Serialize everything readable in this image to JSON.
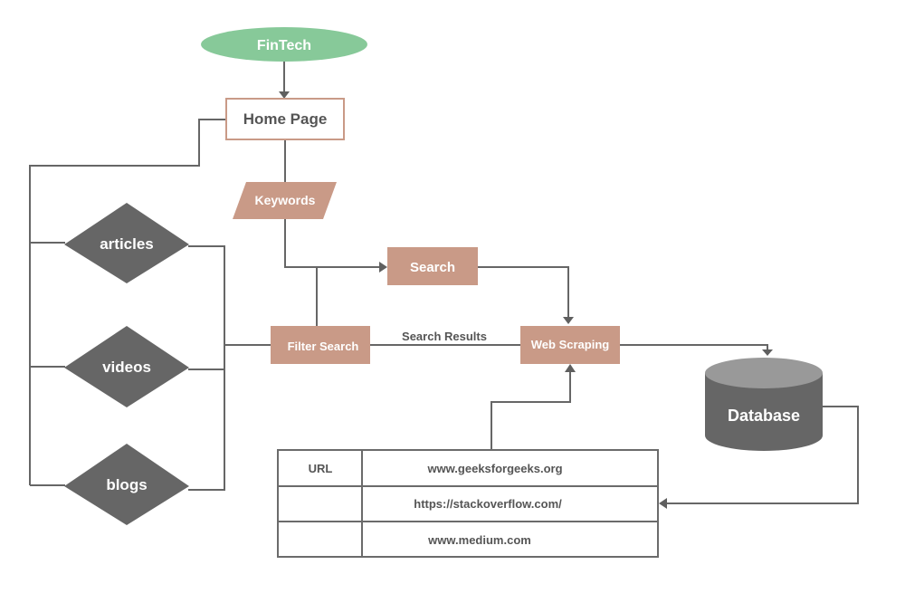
{
  "diagram": {
    "colors": {
      "terminal": "#87c999",
      "process": "#c99a87",
      "decision": "#666666",
      "database_body": "#666666",
      "database_top": "#999999",
      "edge": "#666666",
      "text_light": "#ffffff",
      "text_dark": "#555555"
    },
    "nodes": {
      "fintech": {
        "label": "FinTech",
        "shape": "ellipse"
      },
      "home_page": {
        "label": "Home Page",
        "shape": "rectangle-outline"
      },
      "keywords": {
        "label": "Keywords",
        "shape": "parallelogram"
      },
      "search": {
        "label": "Search",
        "shape": "rectangle"
      },
      "filter_search": {
        "label": "Filter Search",
        "shape": "rectangle"
      },
      "web_scraping": {
        "label": "Web Scraping",
        "shape": "rectangle"
      },
      "database": {
        "label": "Database",
        "shape": "cylinder"
      },
      "articles": {
        "label": "articles",
        "shape": "diamond"
      },
      "videos": {
        "label": "videos",
        "shape": "diamond"
      },
      "blogs": {
        "label": "blogs",
        "shape": "diamond"
      }
    },
    "edge_labels": {
      "search_results": "Search Results"
    },
    "url_table": {
      "header": "URL",
      "rows": [
        "www.geeksforgeeks.org",
        "https://stackoverflow.com/",
        "www.medium.com"
      ]
    },
    "edges": [
      {
        "from": "FinTech",
        "to": "Home Page"
      },
      {
        "from": "Home Page",
        "to": "Keywords"
      },
      {
        "from": "Home Page",
        "to": "articles/videos/blogs"
      },
      {
        "from": "Keywords",
        "to": "Search"
      },
      {
        "from": "Filter Search",
        "to": "Search"
      },
      {
        "from": "articles/videos/blogs",
        "to": "Filter Search"
      },
      {
        "from": "Search",
        "to": "Web Scraping"
      },
      {
        "from": "Filter Search",
        "to": "Web Scraping",
        "label": "Search Results"
      },
      {
        "from": "Web Scraping",
        "to": "Database"
      },
      {
        "from": "URL table",
        "to": "Web Scraping"
      },
      {
        "from": "Database",
        "to": "URL table"
      }
    ]
  }
}
